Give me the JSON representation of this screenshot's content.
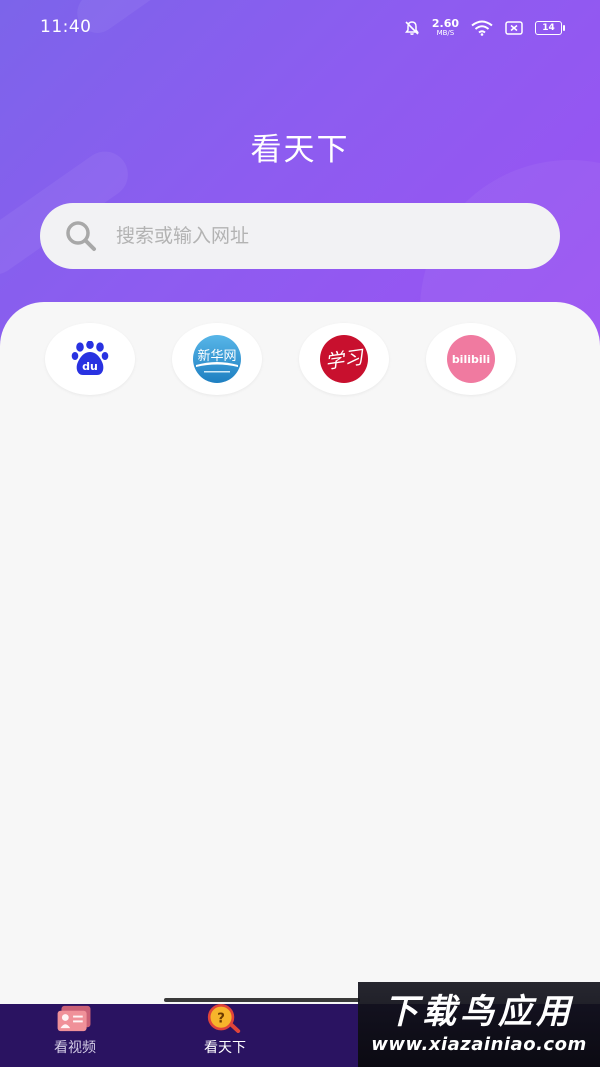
{
  "status_bar": {
    "time": "11:40",
    "net_speed_value": "2.60",
    "net_speed_unit": "MB/S",
    "battery_level": "14"
  },
  "header": {
    "title": "看天下"
  },
  "search": {
    "placeholder": "搜索或输入网址"
  },
  "shortcuts": [
    {
      "icon": "baidu-logo-icon",
      "logo_text": "du",
      "brand_color": "#2932e1"
    },
    {
      "icon": "xinhua-logo-icon",
      "logo_text": "新华网",
      "brand_color": "#1e7fc1"
    },
    {
      "icon": "xuexi-logo-icon",
      "logo_text": "学习",
      "brand_color": "#c8102e"
    },
    {
      "icon": "bilibili-logo-icon",
      "logo_text": "bilibili",
      "brand_color": "#f07aa0"
    }
  ],
  "tab_bar": {
    "tabs": [
      {
        "label": "看视频",
        "icon": "video-card-icon",
        "active": false
      },
      {
        "label": "看天下",
        "icon": "question-magnifier-icon",
        "active": true
      }
    ]
  },
  "watermark": {
    "main": "下载鸟应用",
    "url": "www.xiazainiao.com"
  },
  "colors": {
    "hero_gradient_start": "#7c64ea",
    "hero_gradient_end": "#9b52f3",
    "tab_bar_bg": "#2a1361",
    "page_bg": "#f7f7f7"
  }
}
